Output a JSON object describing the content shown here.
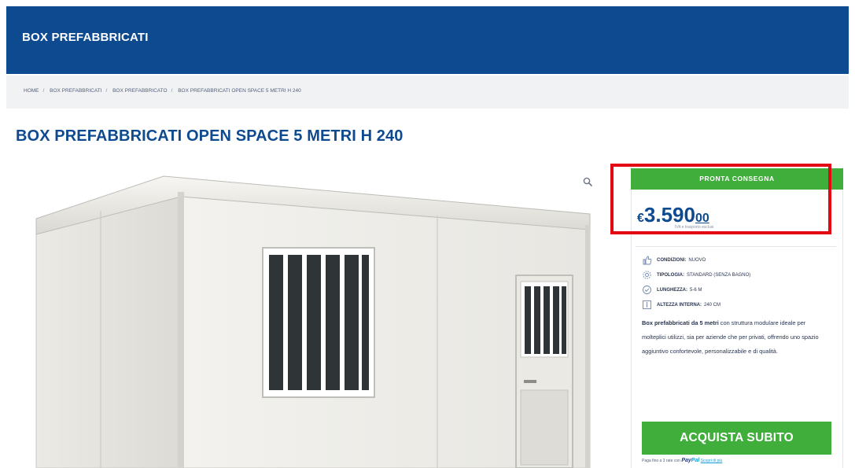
{
  "header": {
    "brand": "BOX PREFABBRICATI"
  },
  "breadcrumb": [
    "HOME",
    "BOX PREFABBRICATI",
    "BOX PREFABBRICATO",
    "BOX PREFABBRICATI OPEN SPACE 5 METRI H 240"
  ],
  "product": {
    "title": "BOX PREFABBRICATI OPEN SPACE 5 METRI H 240",
    "status": "PRONTA CONSEGNA",
    "price": {
      "currency": "€",
      "integer": "3.590",
      "decimal": "00",
      "note": "IVA e trasporto esclusi"
    },
    "specs": [
      {
        "icon": "thumbs-up-icon",
        "label": "CONDIZIONI:",
        "value": "NUOVO"
      },
      {
        "icon": "gear-icon",
        "label": "TIPOLOGIA:",
        "value": "STANDARD (SENZA BAGNO)"
      },
      {
        "icon": "ruler-icon",
        "label": "LUNGHEZZA:",
        "value": "5-6 M"
      },
      {
        "icon": "height-icon",
        "label": "ALTEZZA INTERNA:",
        "value": "240 CM"
      }
    ],
    "description": {
      "bold": "Box prefabbricati da 5 metri",
      "text": " con struttura modulare ideale per molteplici utilizzi, sia per aziende che per privati, offrendo uno spazio aggiuntivo confortevole, personalizzabile e di qualità."
    },
    "buy_label": "ACQUISTA SUBITO",
    "payment": {
      "text": "Paga fino a 3 rate con",
      "brand_a": "Pay",
      "brand_b": "Pal",
      "more": "Scopri di più"
    }
  },
  "colors": {
    "brand": "#0d4a8f",
    "accent": "#3fae3a",
    "highlight": "#e30613"
  }
}
